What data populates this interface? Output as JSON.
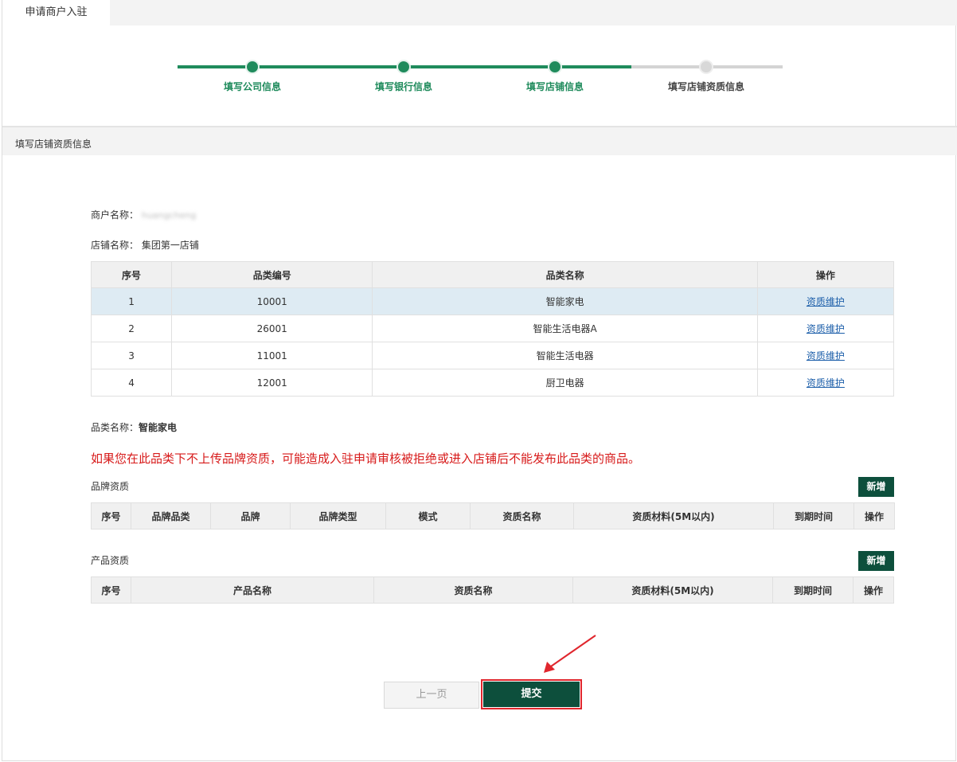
{
  "tab": {
    "label": "申请商户入驻"
  },
  "steps": [
    {
      "label": "填写公司信息",
      "state": "done"
    },
    {
      "label": "填写银行信息",
      "state": "done"
    },
    {
      "label": "填写店铺信息",
      "state": "done"
    },
    {
      "label": "填写店铺资质信息",
      "state": "todo"
    }
  ],
  "colors": {
    "accent": "#1f8b5c",
    "button": "#0d4f3c",
    "warning": "#d71a1a",
    "highlight": "#e0262d"
  },
  "section": {
    "title": "填写店铺资质信息"
  },
  "merchant": {
    "label": "商户名称：",
    "value": "huangcheng"
  },
  "store": {
    "label": "店铺名称：",
    "value": "集团第一店铺"
  },
  "category_table": {
    "headers": [
      "序号",
      "品类编号",
      "品类名称",
      "操作"
    ],
    "rows": [
      {
        "no": "1",
        "code": "10001",
        "name": "智能家电",
        "action": "资质维护"
      },
      {
        "no": "2",
        "code": "26001",
        "name": "智能生活电器A",
        "action": "资质维护"
      },
      {
        "no": "3",
        "code": "11001",
        "name": "智能生活电器",
        "action": "资质维护"
      },
      {
        "no": "4",
        "code": "12001",
        "name": "厨卫电器",
        "action": "资质维护"
      }
    ]
  },
  "selected_category": {
    "label": "品类名称：",
    "value": "智能家电"
  },
  "warning": "如果您在此品类下不上传品牌资质，可能造成入驻申请审核被拒绝或进入店铺后不能发布此品类的商品。",
  "brand_qual": {
    "title": "品牌资质",
    "add_label": "新增",
    "headers": [
      "序号",
      "品牌品类",
      "品牌",
      "品牌类型",
      "模式",
      "资质名称",
      "资质材料(5M以内)",
      "到期时间",
      "操作"
    ]
  },
  "product_qual": {
    "title": "产品资质",
    "add_label": "新增",
    "headers": [
      "序号",
      "产品名称",
      "资质名称",
      "资质材料(5M以内)",
      "到期时间",
      "操作"
    ]
  },
  "footer": {
    "prev_label": "上一页",
    "submit_label": "提交"
  }
}
